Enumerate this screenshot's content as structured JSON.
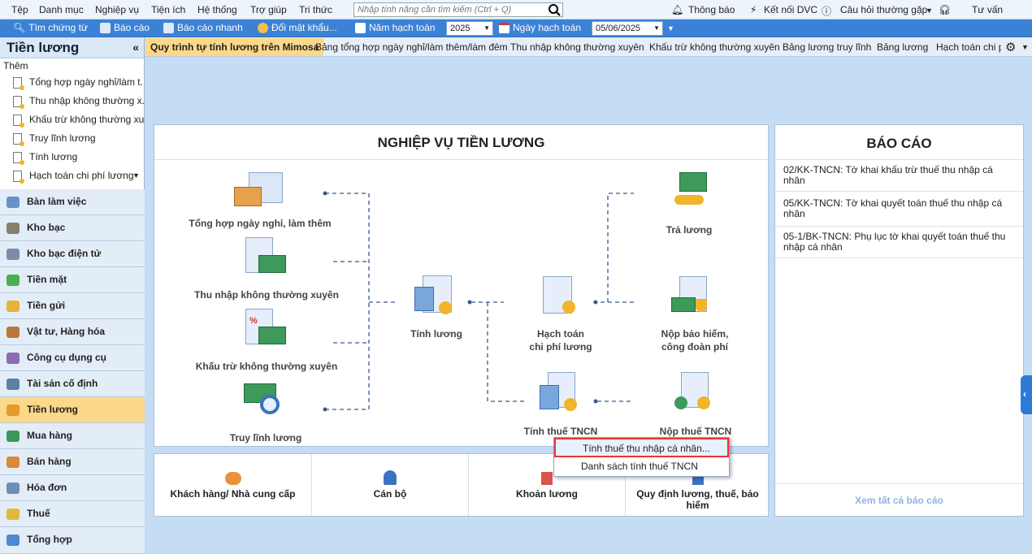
{
  "menu": [
    "Tệp",
    "Danh mục",
    "Nghiệp vụ",
    "Tiện ích",
    "Hệ thống",
    "Trợ giúp",
    "Tri thức"
  ],
  "search_placeholder": "Nhập tính năng cần tìm kiếm (Ctrl + Q)",
  "right_menu": {
    "notify": "Thông báo",
    "dvc": "Kết nối DVC",
    "faq": "Câu hỏi thường gặp",
    "consult": "Tư vấn"
  },
  "toolbar": {
    "find": "Tìm chứng từ",
    "report": "Báo cáo",
    "quick_report": "Báo cáo nhanh",
    "password": "Đổi mật khẩu...",
    "year_label": "Năm hạch toán",
    "year": "2025",
    "date_label": "Ngày hạch toán",
    "date": "05/06/2025"
  },
  "left": {
    "title": "Tiền lương",
    "sub": "Thêm",
    "docs": [
      "Tổng hợp ngày nghỉ/làm t...",
      "Thu nhập không thường x...",
      "Khấu trừ không thường xu...",
      "Truy lĩnh lương",
      "Tính lương",
      "Hạch toán chi phí lương"
    ],
    "modules": [
      "Bàn làm việc",
      "Kho bạc",
      "Kho bạc điện tử",
      "Tiền mặt",
      "Tiền gửi",
      "Vật tư, Hàng hóa",
      "Công cụ dụng cụ",
      "Tài sản cố định",
      "Tiền lương",
      "Mua hàng",
      "Bán hàng",
      "Hóa đơn",
      "Thuế",
      "Tổng hợp"
    ]
  },
  "tabs": [
    "Quy trình tự tính lương trên Mimosa",
    "Bảng tổng hợp ngày nghỉ/làm thêm/làm đêm",
    "Thu nhập không thường xuyên",
    "Khấu trừ không thường xuyên",
    "Bảng lương truy lĩnh",
    "Bảng lương",
    "Hạch toán chi ph"
  ],
  "flow": {
    "title": "NGHIỆP VỤ TIỀN LƯƠNG",
    "n1": "Tổng hợp ngày nghỉ, làm thêm",
    "n2": "Thu nhập không thường xuyên",
    "n3": "Khấu trừ không thường xuyên",
    "n4": "Truy lĩnh lương",
    "n5": "Tính lương",
    "n6a": "Hạch toán",
    "n6b": "chi phí lương",
    "n7": "Trả lương",
    "n8a": "Nộp bảo hiểm,",
    "n8b": "công đoàn phí",
    "n9": "Tính thuế TNCN",
    "n10": "Nộp thuế TNCN"
  },
  "bottom": [
    "Khách hàng/ Nhà cung cấp",
    "Cán bộ",
    "Khoản lương",
    "Quy định lương, thuế, bảo hiểm"
  ],
  "reports": {
    "title": "BÁO CÁO",
    "items": [
      "02/KK-TNCN: Tờ khai khấu trừ thuế thu nhập cá nhân",
      "05/KK-TNCN: Tờ khai quyết toán thuế thu nhập cá nhân",
      "05-1/BK-TNCN: Phụ lục tờ khai quyết toán thuế thu nhập cá nhân"
    ],
    "all": "Xem tất cả báo cáo"
  },
  "context": [
    "Tính thuế thu nhập cá nhân...",
    "Danh sách tính thuế TNCN"
  ]
}
